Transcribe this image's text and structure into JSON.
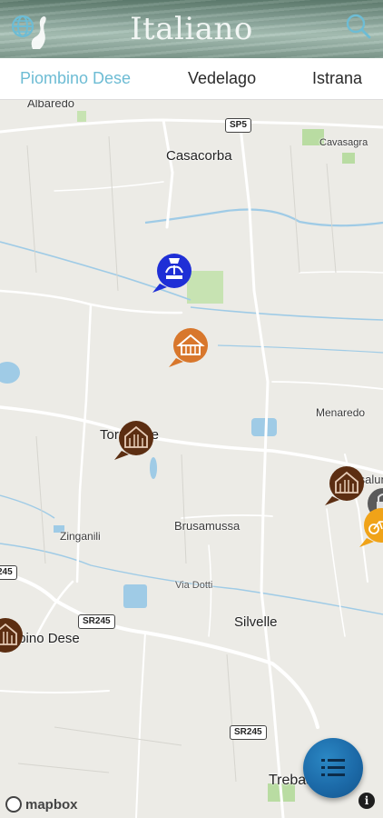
{
  "header": {
    "title": "Italiano",
    "left_icon": "globe-icon",
    "right_icon": "search-icon"
  },
  "tabs": [
    {
      "label": "Piombino Dese",
      "active": true
    },
    {
      "label": "Vedelago",
      "active": false
    },
    {
      "label": "Istrana",
      "active": false
    }
  ],
  "map": {
    "places": {
      "albaredo": "Albaredo",
      "casacorba": "Casacorba",
      "cavasagra": "Cavasagra",
      "menaredo": "Menaredo",
      "torreselle": "Torreselle",
      "fossalunga": "Fossalunga",
      "zinganili": "Zinganili",
      "brusamussa": "Brusamussa",
      "via_dotti": "Via Dotti",
      "silvelle": "Silvelle",
      "piombino_dese": "Piombino Dese",
      "trebaseleghe": "Trebaseleghe"
    },
    "roads": {
      "sp5": "SP5",
      "sr245_a": "SR245",
      "sr245_b": "SR245",
      "r245_edge": "245"
    },
    "pois": [
      {
        "name": "fountain-poi",
        "color": "#1f2fd6"
      },
      {
        "name": "rural-building-poi",
        "color": "#d8772c"
      },
      {
        "name": "villa-poi",
        "color": "#5c2e12"
      },
      {
        "name": "villa-poi",
        "color": "#5c2e12"
      },
      {
        "name": "villa-poi",
        "color": "#5c2e12"
      },
      {
        "name": "bike-poi",
        "color": "#f0a318"
      },
      {
        "name": "lock-poi",
        "color": "#666666"
      }
    ],
    "attribution": "mapbox",
    "info_label": "i"
  },
  "fab": {
    "icon": "list-icon"
  },
  "colors": {
    "accent": "#6dbcd4",
    "fab": "#1c6aa8",
    "map_bg": "#ecebe6",
    "water": "#9fcbe6"
  }
}
